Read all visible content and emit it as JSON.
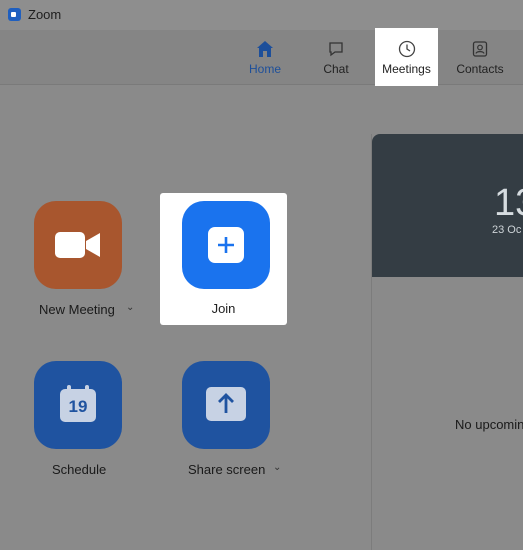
{
  "window": {
    "title": "Zoom"
  },
  "nav": {
    "tabs": [
      {
        "label": "Home",
        "icon": "home-icon",
        "active": true
      },
      {
        "label": "Chat",
        "icon": "chat-icon",
        "active": false
      },
      {
        "label": "Meetings",
        "icon": "clock-icon",
        "highlighted": true
      },
      {
        "label": "Contacts",
        "icon": "contacts-icon",
        "active": false
      }
    ]
  },
  "actions": {
    "new_meeting": {
      "label": "New Meeting",
      "icon": "video-camera-icon",
      "color": "#a8562e",
      "has_dropdown": true
    },
    "join": {
      "label": "Join",
      "icon": "plus-icon",
      "color": "#1a73ee"
    },
    "schedule": {
      "label": "Schedule",
      "icon": "calendar-icon",
      "calendar_day": "19",
      "color": "#1f53a0"
    },
    "share_screen": {
      "label": "Share screen",
      "icon": "share-up-arrow-icon",
      "color": "#1f53a0",
      "has_dropdown": true
    }
  },
  "right_panel": {
    "time": "13",
    "date": "23 Oc",
    "empty_message": "No upcomin"
  },
  "colors": {
    "active_tab": "#1d4f9a",
    "overlay": "#8a8a8a"
  }
}
